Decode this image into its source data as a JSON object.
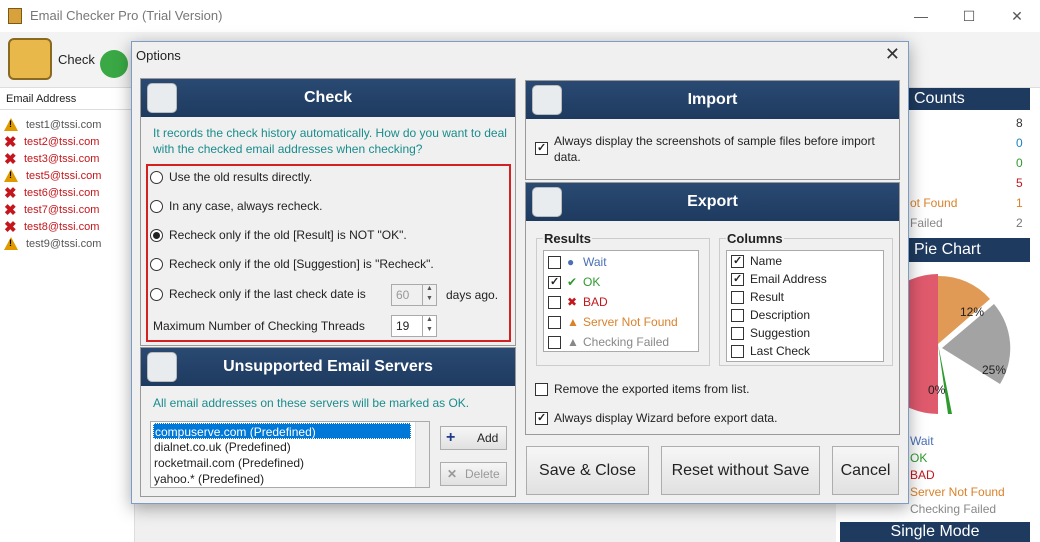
{
  "app": {
    "title": "Email Checker Pro (Trial Version)",
    "toolbar_check": "Check"
  },
  "window_controls": {
    "minimize": "—",
    "maximize": "☐",
    "close": "✕"
  },
  "grid": {
    "column": "Email Address",
    "rows": [
      {
        "email": "test1@tssi.com",
        "status": "warn",
        "color": "#555555"
      },
      {
        "email": "test2@tssi.com",
        "status": "bad",
        "color": "#c4161c"
      },
      {
        "email": "test3@tssi.com",
        "status": "bad",
        "color": "#c4161c"
      },
      {
        "email": "test5@tssi.com",
        "status": "warn",
        "color": "#c4161c"
      },
      {
        "email": "test6@tssi.com",
        "status": "bad",
        "color": "#c4161c"
      },
      {
        "email": "test7@tssi.com",
        "status": "bad",
        "color": "#c4161c"
      },
      {
        "email": "test8@tssi.com",
        "status": "bad",
        "color": "#c4161c"
      },
      {
        "email": "test9@tssi.com",
        "status": "warn",
        "color": "#555555"
      }
    ]
  },
  "right_panel": {
    "counts_title": "Counts",
    "counts": [
      "8",
      "0",
      "0",
      "5",
      "1",
      "2"
    ],
    "count_labels": [
      "ot Found",
      "Failed"
    ],
    "pie_title": "Pie Chart",
    "pie_labels": [
      "12%",
      "25%",
      "0%"
    ],
    "legend": [
      "Wait",
      "OK",
      "BAD",
      "Server Not Found",
      "Checking Failed"
    ],
    "legend_colors": [
      "#4a6fb5",
      "#2e9a2e",
      "#c4161c",
      "#d9822b",
      "#888888"
    ],
    "single_mode": "Single Mode"
  },
  "dialog": {
    "title": "Options",
    "close": "✕",
    "check": {
      "title": "Check",
      "intro": "It records the check history automatically. How do you want to deal with the checked email addresses when checking?",
      "options": [
        "Use the old results directly.",
        "In any case, always recheck.",
        "Recheck only if the old [Result] is NOT \"OK\".",
        "Recheck only if the old [Suggestion] is \"Recheck\".",
        "Recheck only if the last check date is"
      ],
      "selected_index": 2,
      "days_value": "60",
      "days_suffix": "days ago.",
      "threads_label": "Maximum Number of Checking Threads",
      "threads_value": "19"
    },
    "unsupported": {
      "title": "Unsupported Email Servers",
      "intro": "All email addresses on these servers will be marked as OK.",
      "servers": [
        "compuserve.com (Predefined)",
        "dialnet.co.uk (Predefined)",
        "rocketmail.com (Predefined)",
        "yahoo.* (Predefined)"
      ],
      "add": "Add",
      "delete": "Delete"
    },
    "import": {
      "title": "Import",
      "option": "Always display the screenshots of sample files before import data."
    },
    "export": {
      "title": "Export",
      "results_title": "Results",
      "results": [
        {
          "label": "Wait",
          "checked": false,
          "color": "#4a6fb5"
        },
        {
          "label": "OK",
          "checked": true,
          "color": "#2e9a2e"
        },
        {
          "label": "BAD",
          "checked": false,
          "color": "#c4161c"
        },
        {
          "label": "Server Not Found",
          "checked": false,
          "color": "#d9822b"
        },
        {
          "label": "Checking Failed",
          "checked": false,
          "color": "#888888"
        }
      ],
      "columns_title": "Columns",
      "columns": [
        {
          "label": "Name",
          "checked": true
        },
        {
          "label": "Email Address",
          "checked": true
        },
        {
          "label": "Result",
          "checked": false
        },
        {
          "label": "Description",
          "checked": false
        },
        {
          "label": "Suggestion",
          "checked": false
        },
        {
          "label": "Last Check",
          "checked": false
        }
      ],
      "remove_option": "Remove the exported items from list.",
      "wizard_option": "Always display Wizard before export data."
    },
    "buttons": {
      "save": "Save & Close",
      "reset": "Reset without Save",
      "cancel": "Cancel"
    }
  }
}
